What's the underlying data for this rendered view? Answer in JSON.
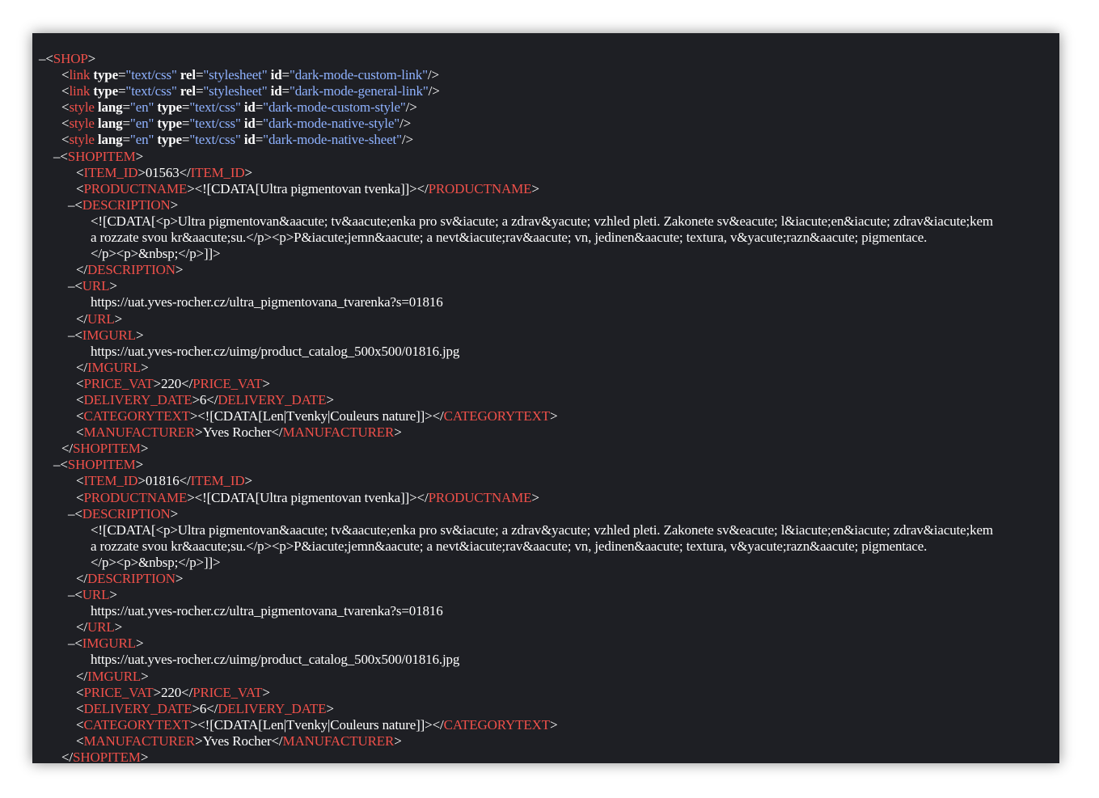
{
  "lines": [
    {
      "indent": 0,
      "parts": [
        [
          "toggle",
          "–"
        ],
        [
          "punct",
          "<"
        ],
        [
          "tag",
          "SHOP"
        ],
        [
          "punct",
          ">"
        ]
      ]
    },
    {
      "indent": 28,
      "parts": [
        [
          "punct",
          "<"
        ],
        [
          "tag",
          "link"
        ],
        [
          "txt",
          " "
        ],
        [
          "attr",
          "type"
        ],
        [
          "punct",
          "="
        ],
        [
          "val",
          "\"text/css\""
        ],
        [
          "txt",
          " "
        ],
        [
          "attr",
          "rel"
        ],
        [
          "punct",
          "="
        ],
        [
          "val",
          "\"stylesheet\""
        ],
        [
          "txt",
          " "
        ],
        [
          "attr",
          "id"
        ],
        [
          "punct",
          "="
        ],
        [
          "val",
          "\"dark-mode-custom-link\""
        ],
        [
          "punct",
          "/>"
        ]
      ]
    },
    {
      "indent": 28,
      "parts": [
        [
          "punct",
          "<"
        ],
        [
          "tag",
          "link"
        ],
        [
          "txt",
          " "
        ],
        [
          "attr",
          "type"
        ],
        [
          "punct",
          "="
        ],
        [
          "val",
          "\"text/css\""
        ],
        [
          "txt",
          " "
        ],
        [
          "attr",
          "rel"
        ],
        [
          "punct",
          "="
        ],
        [
          "val",
          "\"stylesheet\""
        ],
        [
          "txt",
          " "
        ],
        [
          "attr",
          "id"
        ],
        [
          "punct",
          "="
        ],
        [
          "val",
          "\"dark-mode-general-link\""
        ],
        [
          "punct",
          "/>"
        ]
      ]
    },
    {
      "indent": 28,
      "parts": [
        [
          "punct",
          "<"
        ],
        [
          "tag",
          "style"
        ],
        [
          "txt",
          " "
        ],
        [
          "attr",
          "lang"
        ],
        [
          "punct",
          "="
        ],
        [
          "val",
          "\"en\""
        ],
        [
          "txt",
          " "
        ],
        [
          "attr",
          "type"
        ],
        [
          "punct",
          "="
        ],
        [
          "val",
          "\"text/css\""
        ],
        [
          "txt",
          " "
        ],
        [
          "attr",
          "id"
        ],
        [
          "punct",
          "="
        ],
        [
          "val",
          "\"dark-mode-custom-style\""
        ],
        [
          "punct",
          "/>"
        ]
      ]
    },
    {
      "indent": 28,
      "parts": [
        [
          "punct",
          "<"
        ],
        [
          "tag",
          "style"
        ],
        [
          "txt",
          " "
        ],
        [
          "attr",
          "lang"
        ],
        [
          "punct",
          "="
        ],
        [
          "val",
          "\"en\""
        ],
        [
          "txt",
          " "
        ],
        [
          "attr",
          "type"
        ],
        [
          "punct",
          "="
        ],
        [
          "val",
          "\"text/css\""
        ],
        [
          "txt",
          " "
        ],
        [
          "attr",
          "id"
        ],
        [
          "punct",
          "="
        ],
        [
          "val",
          "\"dark-mode-native-style\""
        ],
        [
          "punct",
          "/>"
        ]
      ]
    },
    {
      "indent": 28,
      "parts": [
        [
          "punct",
          "<"
        ],
        [
          "tag",
          "style"
        ],
        [
          "txt",
          " "
        ],
        [
          "attr",
          "lang"
        ],
        [
          "punct",
          "="
        ],
        [
          "val",
          "\"en\""
        ],
        [
          "txt",
          " "
        ],
        [
          "attr",
          "type"
        ],
        [
          "punct",
          "="
        ],
        [
          "val",
          "\"text/css\""
        ],
        [
          "txt",
          " "
        ],
        [
          "attr",
          "id"
        ],
        [
          "punct",
          "="
        ],
        [
          "val",
          "\"dark-mode-native-sheet\""
        ],
        [
          "punct",
          "/>"
        ]
      ]
    },
    {
      "indent": 18,
      "parts": [
        [
          "toggle",
          "–"
        ],
        [
          "punct",
          "<"
        ],
        [
          "tag",
          "SHOPITEM"
        ],
        [
          "punct",
          ">"
        ]
      ]
    },
    {
      "indent": 46,
      "parts": [
        [
          "punct",
          "<"
        ],
        [
          "tag",
          "ITEM_ID"
        ],
        [
          "punct",
          ">"
        ],
        [
          "txt",
          "01563"
        ],
        [
          "punct",
          "</"
        ],
        [
          "tag",
          "ITEM_ID"
        ],
        [
          "punct",
          ">"
        ]
      ]
    },
    {
      "indent": 46,
      "parts": [
        [
          "punct",
          "<"
        ],
        [
          "tag",
          "PRODUCTNAME"
        ],
        [
          "punct",
          ">"
        ],
        [
          "txt",
          "<![CDATA[Ultra pigmentovan tvenka]]>"
        ],
        [
          "punct",
          "</"
        ],
        [
          "tag",
          "PRODUCTNAME"
        ],
        [
          "punct",
          ">"
        ]
      ]
    },
    {
      "indent": 36,
      "parts": [
        [
          "toggle",
          "–"
        ],
        [
          "punct",
          "<"
        ],
        [
          "tag",
          "DESCRIPTION"
        ],
        [
          "punct",
          ">"
        ]
      ]
    },
    {
      "indent": 64,
      "parts": [
        [
          "txt",
          "<![CDATA[<p>Ultra pigmentovan&aacute; tv&aacute;enka pro sv&iacute; a zdrav&yacute; vzhled pleti. Zakonete sv&eacute; l&iacute;en&iacute; zdrav&iacute;kem"
        ]
      ]
    },
    {
      "indent": 64,
      "parts": [
        [
          "txt",
          "a rozzate svou kr&aacute;su.</p><p>P&iacute;jemn&aacute; a nevt&iacute;rav&aacute; vn, jedinen&aacute; textura, v&yacute;razn&aacute; pigmentace."
        ]
      ]
    },
    {
      "indent": 64,
      "parts": [
        [
          "txt",
          "</p><p>&nbsp;</p>]]>"
        ]
      ]
    },
    {
      "indent": 46,
      "parts": [
        [
          "punct",
          "</"
        ],
        [
          "tag",
          "DESCRIPTION"
        ],
        [
          "punct",
          ">"
        ]
      ]
    },
    {
      "indent": 36,
      "parts": [
        [
          "toggle",
          "–"
        ],
        [
          "punct",
          "<"
        ],
        [
          "tag",
          "URL"
        ],
        [
          "punct",
          ">"
        ]
      ]
    },
    {
      "indent": 64,
      "parts": [
        [
          "txt",
          "https://uat.yves-rocher.cz/ultra_pigmentovana_tvarenka?s=01816"
        ]
      ]
    },
    {
      "indent": 46,
      "parts": [
        [
          "punct",
          "</"
        ],
        [
          "tag",
          "URL"
        ],
        [
          "punct",
          ">"
        ]
      ]
    },
    {
      "indent": 36,
      "parts": [
        [
          "toggle",
          "–"
        ],
        [
          "punct",
          "<"
        ],
        [
          "tag",
          "IMGURL"
        ],
        [
          "punct",
          ">"
        ]
      ]
    },
    {
      "indent": 64,
      "parts": [
        [
          "txt",
          "https://uat.yves-rocher.cz/uimg/product_catalog_500x500/01816.jpg"
        ]
      ]
    },
    {
      "indent": 46,
      "parts": [
        [
          "punct",
          "</"
        ],
        [
          "tag",
          "IMGURL"
        ],
        [
          "punct",
          ">"
        ]
      ]
    },
    {
      "indent": 46,
      "parts": [
        [
          "punct",
          "<"
        ],
        [
          "tag",
          "PRICE_VAT"
        ],
        [
          "punct",
          ">"
        ],
        [
          "txt",
          "220"
        ],
        [
          "punct",
          "</"
        ],
        [
          "tag",
          "PRICE_VAT"
        ],
        [
          "punct",
          ">"
        ]
      ]
    },
    {
      "indent": 46,
      "parts": [
        [
          "punct",
          "<"
        ],
        [
          "tag",
          "DELIVERY_DATE"
        ],
        [
          "punct",
          ">"
        ],
        [
          "txt",
          "6"
        ],
        [
          "punct",
          "</"
        ],
        [
          "tag",
          "DELIVERY_DATE"
        ],
        [
          "punct",
          ">"
        ]
      ]
    },
    {
      "indent": 46,
      "parts": [
        [
          "punct",
          "<"
        ],
        [
          "tag",
          "CATEGORYTEXT"
        ],
        [
          "punct",
          ">"
        ],
        [
          "txt",
          "<![CDATA[Len|Tvenky|Couleurs nature]]>"
        ],
        [
          "punct",
          "</"
        ],
        [
          "tag",
          "CATEGORYTEXT"
        ],
        [
          "punct",
          ">"
        ]
      ]
    },
    {
      "indent": 46,
      "parts": [
        [
          "punct",
          "<"
        ],
        [
          "tag",
          "MANUFACTURER"
        ],
        [
          "punct",
          ">"
        ],
        [
          "txt",
          "Yves Rocher"
        ],
        [
          "punct",
          "</"
        ],
        [
          "tag",
          "MANUFACTURER"
        ],
        [
          "punct",
          ">"
        ]
      ]
    },
    {
      "indent": 28,
      "parts": [
        [
          "punct",
          "</"
        ],
        [
          "tag",
          "SHOPITEM"
        ],
        [
          "punct",
          ">"
        ]
      ]
    },
    {
      "indent": 18,
      "parts": [
        [
          "toggle",
          "–"
        ],
        [
          "punct",
          "<"
        ],
        [
          "tag",
          "SHOPITEM"
        ],
        [
          "punct",
          ">"
        ]
      ]
    },
    {
      "indent": 46,
      "parts": [
        [
          "punct",
          "<"
        ],
        [
          "tag",
          "ITEM_ID"
        ],
        [
          "punct",
          ">"
        ],
        [
          "txt",
          "01816"
        ],
        [
          "punct",
          "</"
        ],
        [
          "tag",
          "ITEM_ID"
        ],
        [
          "punct",
          ">"
        ]
      ]
    },
    {
      "indent": 46,
      "parts": [
        [
          "punct",
          "<"
        ],
        [
          "tag",
          "PRODUCTNAME"
        ],
        [
          "punct",
          ">"
        ],
        [
          "txt",
          "<![CDATA[Ultra pigmentovan tvenka]]>"
        ],
        [
          "punct",
          "</"
        ],
        [
          "tag",
          "PRODUCTNAME"
        ],
        [
          "punct",
          ">"
        ]
      ]
    },
    {
      "indent": 36,
      "parts": [
        [
          "toggle",
          "–"
        ],
        [
          "punct",
          "<"
        ],
        [
          "tag",
          "DESCRIPTION"
        ],
        [
          "punct",
          ">"
        ]
      ]
    },
    {
      "indent": 64,
      "parts": [
        [
          "txt",
          "<![CDATA[<p>Ultra pigmentovan&aacute; tv&aacute;enka pro sv&iacute; a zdrav&yacute; vzhled pleti. Zakonete sv&eacute; l&iacute;en&iacute; zdrav&iacute;kem"
        ]
      ]
    },
    {
      "indent": 64,
      "parts": [
        [
          "txt",
          "a rozzate svou kr&aacute;su.</p><p>P&iacute;jemn&aacute; a nevt&iacute;rav&aacute; vn, jedinen&aacute; textura, v&yacute;razn&aacute; pigmentace."
        ]
      ]
    },
    {
      "indent": 64,
      "parts": [
        [
          "txt",
          "</p><p>&nbsp;</p>]]>"
        ]
      ]
    },
    {
      "indent": 46,
      "parts": [
        [
          "punct",
          "</"
        ],
        [
          "tag",
          "DESCRIPTION"
        ],
        [
          "punct",
          ">"
        ]
      ]
    },
    {
      "indent": 36,
      "parts": [
        [
          "toggle",
          "–"
        ],
        [
          "punct",
          "<"
        ],
        [
          "tag",
          "URL"
        ],
        [
          "punct",
          ">"
        ]
      ]
    },
    {
      "indent": 64,
      "parts": [
        [
          "txt",
          "https://uat.yves-rocher.cz/ultra_pigmentovana_tvarenka?s=01816"
        ]
      ]
    },
    {
      "indent": 46,
      "parts": [
        [
          "punct",
          "</"
        ],
        [
          "tag",
          "URL"
        ],
        [
          "punct",
          ">"
        ]
      ]
    },
    {
      "indent": 36,
      "parts": [
        [
          "toggle",
          "–"
        ],
        [
          "punct",
          "<"
        ],
        [
          "tag",
          "IMGURL"
        ],
        [
          "punct",
          ">"
        ]
      ]
    },
    {
      "indent": 64,
      "parts": [
        [
          "txt",
          "https://uat.yves-rocher.cz/uimg/product_catalog_500x500/01816.jpg"
        ]
      ]
    },
    {
      "indent": 46,
      "parts": [
        [
          "punct",
          "</"
        ],
        [
          "tag",
          "IMGURL"
        ],
        [
          "punct",
          ">"
        ]
      ]
    },
    {
      "indent": 46,
      "parts": [
        [
          "punct",
          "<"
        ],
        [
          "tag",
          "PRICE_VAT"
        ],
        [
          "punct",
          ">"
        ],
        [
          "txt",
          "220"
        ],
        [
          "punct",
          "</"
        ],
        [
          "tag",
          "PRICE_VAT"
        ],
        [
          "punct",
          ">"
        ]
      ]
    },
    {
      "indent": 46,
      "parts": [
        [
          "punct",
          "<"
        ],
        [
          "tag",
          "DELIVERY_DATE"
        ],
        [
          "punct",
          ">"
        ],
        [
          "txt",
          "6"
        ],
        [
          "punct",
          "</"
        ],
        [
          "tag",
          "DELIVERY_DATE"
        ],
        [
          "punct",
          ">"
        ]
      ]
    },
    {
      "indent": 46,
      "parts": [
        [
          "punct",
          "<"
        ],
        [
          "tag",
          "CATEGORYTEXT"
        ],
        [
          "punct",
          ">"
        ],
        [
          "txt",
          "<![CDATA[Len|Tvenky|Couleurs nature]]>"
        ],
        [
          "punct",
          "</"
        ],
        [
          "tag",
          "CATEGORYTEXT"
        ],
        [
          "punct",
          ">"
        ]
      ]
    },
    {
      "indent": 46,
      "parts": [
        [
          "punct",
          "<"
        ],
        [
          "tag",
          "MANUFACTURER"
        ],
        [
          "punct",
          ">"
        ],
        [
          "txt",
          "Yves Rocher"
        ],
        [
          "punct",
          "</"
        ],
        [
          "tag",
          "MANUFACTURER"
        ],
        [
          "punct",
          ">"
        ]
      ]
    },
    {
      "indent": 28,
      "parts": [
        [
          "punct",
          "</"
        ],
        [
          "tag",
          "SHOPITEM"
        ],
        [
          "punct",
          ">"
        ]
      ]
    }
  ]
}
